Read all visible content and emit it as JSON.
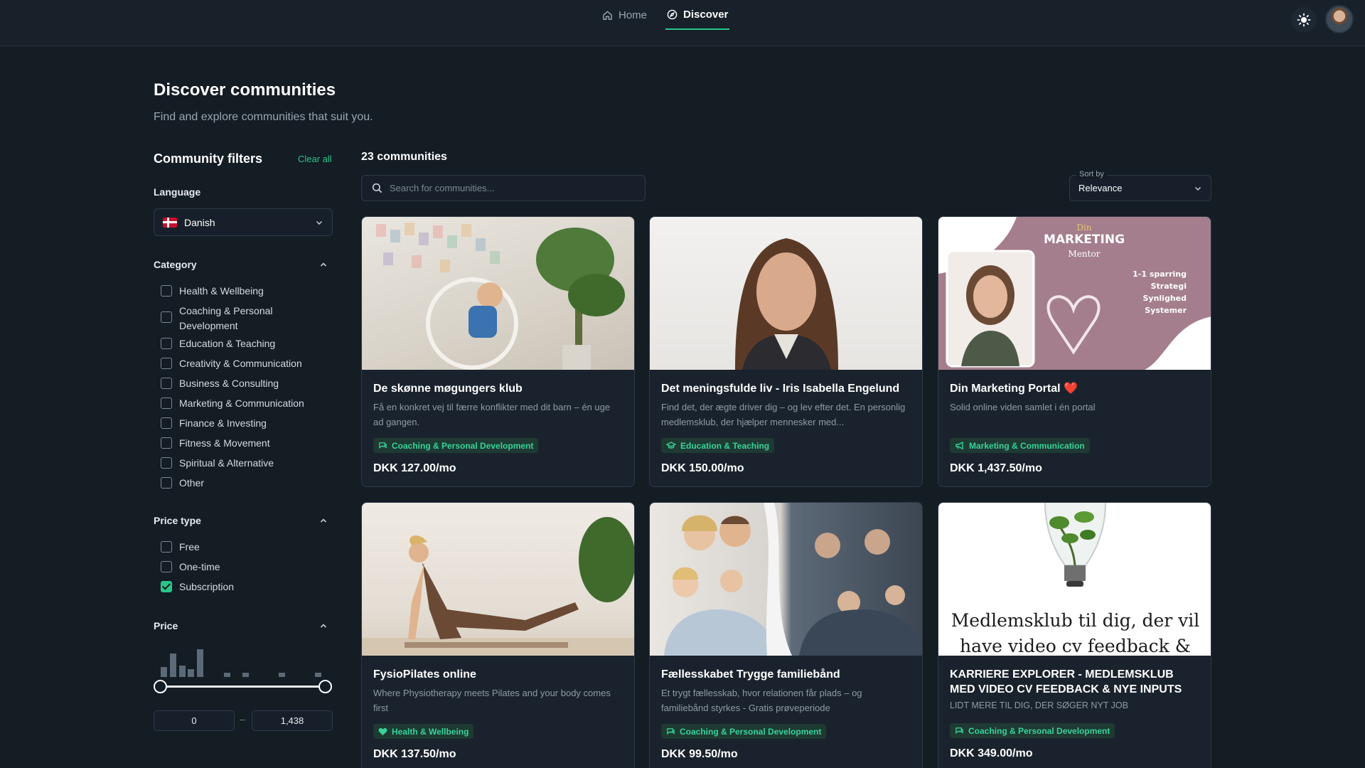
{
  "nav": {
    "tabs": [
      {
        "label": "Home",
        "icon": "home-icon"
      },
      {
        "label": "Discover",
        "icon": "compass-icon",
        "active": true
      }
    ]
  },
  "header": {
    "title": "Discover communities",
    "subtitle": "Find and explore communities that suit you."
  },
  "filters": {
    "title": "Community filters",
    "clear_all": "Clear all",
    "language": {
      "label": "Language",
      "value": "Danish"
    },
    "category": {
      "label": "Category",
      "options": [
        {
          "label": "Health & Wellbeing",
          "checked": false
        },
        {
          "label": "Coaching & Personal Development",
          "checked": false
        },
        {
          "label": "Education & Teaching",
          "checked": false
        },
        {
          "label": "Creativity & Communication",
          "checked": false
        },
        {
          "label": "Business & Consulting",
          "checked": false
        },
        {
          "label": "Marketing & Communication",
          "checked": false
        },
        {
          "label": "Finance & Investing",
          "checked": false
        },
        {
          "label": "Fitness & Movement",
          "checked": false
        },
        {
          "label": "Spiritual & Alternative",
          "checked": false
        },
        {
          "label": "Other",
          "checked": false
        }
      ]
    },
    "price_type": {
      "label": "Price type",
      "options": [
        {
          "label": "Free",
          "checked": false
        },
        {
          "label": "One-time",
          "checked": false
        },
        {
          "label": "Subscription",
          "checked": true
        }
      ]
    },
    "price": {
      "label": "Price",
      "min": "0",
      "max": "1,438",
      "dash": "–",
      "histogram": [
        0.25,
        0.62,
        0.3,
        0.2,
        0.72,
        0,
        0,
        0.1,
        0,
        0.1,
        0,
        0,
        0,
        0.1,
        0,
        0,
        0,
        0.1
      ]
    }
  },
  "results": {
    "count": "23 communities",
    "search_placeholder": "Search for communities...",
    "sort": {
      "label": "Sort by",
      "value": "Relevance"
    },
    "cards": [
      {
        "title": "De skønne møgungers klub",
        "description": "Få en konkret vej til færre konflikter med dit barn – én uge ad gangen.",
        "tag": "Coaching & Personal Development",
        "tag_icon": "chat-icon",
        "price": "DKK 127.00/mo"
      },
      {
        "title": "Det meningsfulde liv - Iris Isabella Engelund",
        "description": "Find det, der ægte driver dig – og lev efter det. En personlig medlemsklub, der hjælper mennesker med...",
        "tag": "Education & Teaching",
        "tag_icon": "graduation-cap-icon",
        "price": "DKK 150.00/mo"
      },
      {
        "title": "Din Marketing Portal ❤️",
        "description": "Solid online viden samlet i én portal",
        "tag": "Marketing & Communication",
        "tag_icon": "megaphone-icon",
        "price": "DKK 1,437.50/mo",
        "image_text": {
          "line1": "Din",
          "line2": "MARKETING",
          "line3": "Mentor",
          "bullets": [
            "1-1 sparring",
            "Strategi",
            "Synlighed",
            "Systemer"
          ]
        }
      },
      {
        "title": "FysioPilates online",
        "description": "Where Physiotherapy meets Pilates and your body comes first",
        "tag": "Health & Wellbeing",
        "tag_icon": "heart-icon",
        "price": "DKK 137.50/mo"
      },
      {
        "title": "Fællesskabet Trygge familiebånd",
        "description": "Et trygt fællesskab, hvor relationen får plads – og familiebånd styrkes - Gratis prøveperiode",
        "tag": "Coaching & Personal Development",
        "tag_icon": "chat-icon",
        "price": "DKK 99.50/mo"
      },
      {
        "title": "KARRIERE EXPLORER - MEDLEMSKLUB MED VIDEO CV FEEDBACK & NYE INPUTS TIL DIN...",
        "description": "LIDT MERE TIL DIG, DER SØGER NYT JOB",
        "tag": "Coaching & Personal Development",
        "tag_icon": "chat-icon",
        "price": "DKK 349.00/mo",
        "image_text": {
          "line1": "Medlemsklub til dig, der vil",
          "line2": "have video cv feedback &"
        }
      }
    ]
  }
}
